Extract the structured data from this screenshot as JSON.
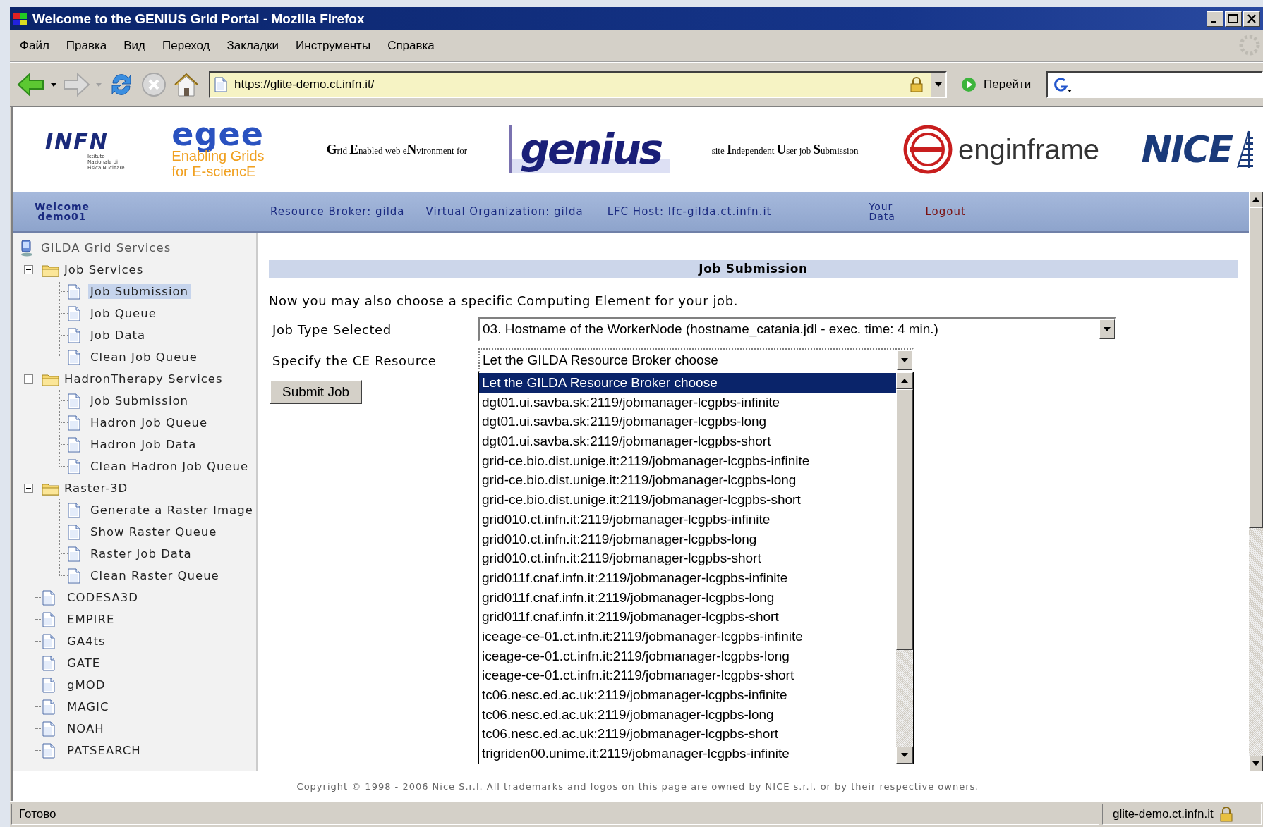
{
  "window": {
    "title": "Welcome to the GENIUS Grid Portal - Mozilla Firefox"
  },
  "menu": [
    {
      "label": "Файл"
    },
    {
      "label": "Правка"
    },
    {
      "label": "Вид"
    },
    {
      "label": "Переход"
    },
    {
      "label": "Закладки"
    },
    {
      "label": "Инструменты"
    },
    {
      "label": "Справка"
    }
  ],
  "toolbar": {
    "url": "https://glite-demo.ct.infn.it/",
    "go": "Перейти"
  },
  "banner": {
    "infn": "INFN",
    "infn_sub": "Istituto Nazionale di Fisica Nucleare",
    "egee": "egee",
    "egee_sub": "Enabling Grids for E-sciencE",
    "genius_caption": "**G**rid **E**nabled web e**N**vironment for",
    "genius": "genius",
    "siu_caption": "site **I**ndependent **U**ser job **S**ubmission",
    "enginframe": "enginframe",
    "nice": "NICE"
  },
  "info_bar": {
    "welcome": "Welcome",
    "user": "demo01",
    "broker": "Resource Broker: gilda",
    "vo": "Virtual Organization: gilda",
    "lfc": "LFC Host: lfc-gilda.ct.infn.it",
    "your_data": "Your Data",
    "logout": "Logout"
  },
  "sidebar": {
    "root": "GILDA Grid Services",
    "items": [
      {
        "label": "Job Services",
        "expanded": true,
        "children": [
          {
            "label": "Job Submission",
            "selected": true
          },
          {
            "label": "Job Queue",
            "selected": false
          },
          {
            "label": "Job Data",
            "selected": false
          },
          {
            "label": "Clean Job Queue",
            "selected": false
          }
        ]
      },
      {
        "label": "HadronTherapy Services",
        "expanded": true,
        "children": [
          {
            "label": "Job Submission",
            "selected": false
          },
          {
            "label": "Hadron Job Queue",
            "selected": false
          },
          {
            "label": "Hadron Job Data",
            "selected": false
          },
          {
            "label": "Clean Hadron Job Queue",
            "selected": false
          }
        ]
      },
      {
        "label": "Raster-3D",
        "expanded": true,
        "children": [
          {
            "label": "Generate a Raster Image",
            "selected": false
          },
          {
            "label": "Show Raster Queue",
            "selected": false
          },
          {
            "label": "Raster Job Data",
            "selected": false
          },
          {
            "label": "Clean Raster Queue",
            "selected": false
          }
        ]
      },
      {
        "label": "CODESA3D",
        "selected": false
      },
      {
        "label": "EMPIRE",
        "selected": false
      },
      {
        "label": "GA4ts",
        "selected": false
      },
      {
        "label": "GATE",
        "selected": false
      },
      {
        "label": "gMOD",
        "selected": false
      },
      {
        "label": "MAGIC",
        "selected": false
      },
      {
        "label": "NOAH",
        "selected": false
      },
      {
        "label": "PATSEARCH",
        "selected": false
      }
    ]
  },
  "main": {
    "heading": "Job Submission",
    "intro": "Now you may also choose a specific Computing Element for your job.",
    "job_type": {
      "label": "Job Type Selected",
      "value": "03. Hostname of the WorkerNode (hostname_catania.jdl - exec. time: 4 min.)"
    },
    "ce": {
      "label": "Specify the CE Resource",
      "value": "Let the GILDA Resource Broker choose",
      "options": [
        {
          "label": "Let the GILDA Resource Broker choose",
          "selected": true
        },
        {
          "label": "dgt01.ui.savba.sk:2119/jobmanager-lcgpbs-infinite",
          "selected": false
        },
        {
          "label": "dgt01.ui.savba.sk:2119/jobmanager-lcgpbs-long",
          "selected": false
        },
        {
          "label": "dgt01.ui.savba.sk:2119/jobmanager-lcgpbs-short",
          "selected": false
        },
        {
          "label": "grid-ce.bio.dist.unige.it:2119/jobmanager-lcgpbs-infinite",
          "selected": false
        },
        {
          "label": "grid-ce.bio.dist.unige.it:2119/jobmanager-lcgpbs-long",
          "selected": false
        },
        {
          "label": "grid-ce.bio.dist.unige.it:2119/jobmanager-lcgpbs-short",
          "selected": false
        },
        {
          "label": "grid010.ct.infn.it:2119/jobmanager-lcgpbs-infinite",
          "selected": false
        },
        {
          "label": "grid010.ct.infn.it:2119/jobmanager-lcgpbs-long",
          "selected": false
        },
        {
          "label": "grid010.ct.infn.it:2119/jobmanager-lcgpbs-short",
          "selected": false
        },
        {
          "label": "grid011f.cnaf.infn.it:2119/jobmanager-lcgpbs-infinite",
          "selected": false
        },
        {
          "label": "grid011f.cnaf.infn.it:2119/jobmanager-lcgpbs-long",
          "selected": false
        },
        {
          "label": "grid011f.cnaf.infn.it:2119/jobmanager-lcgpbs-short",
          "selected": false
        },
        {
          "label": "iceage-ce-01.ct.infn.it:2119/jobmanager-lcgpbs-infinite",
          "selected": false
        },
        {
          "label": "iceage-ce-01.ct.infn.it:2119/jobmanager-lcgpbs-long",
          "selected": false
        },
        {
          "label": "iceage-ce-01.ct.infn.it:2119/jobmanager-lcgpbs-short",
          "selected": false
        },
        {
          "label": "tc06.nesc.ed.ac.uk:2119/jobmanager-lcgpbs-infinite",
          "selected": false
        },
        {
          "label": "tc06.nesc.ed.ac.uk:2119/jobmanager-lcgpbs-long",
          "selected": false
        },
        {
          "label": "tc06.nesc.ed.ac.uk:2119/jobmanager-lcgpbs-short",
          "selected": false
        },
        {
          "label": "trigriden00.unime.it:2119/jobmanager-lcgpbs-infinite",
          "selected": false
        }
      ]
    },
    "submit": "Submit Job"
  },
  "footer": "Copyright © 1998 - 2006 Nice S.r.l. All trademarks and logos on this page are owned by NICE s.r.l. or by their respective owners.",
  "status_bar": {
    "text": "Готово",
    "host": "glite-demo.ct.infn.it"
  }
}
